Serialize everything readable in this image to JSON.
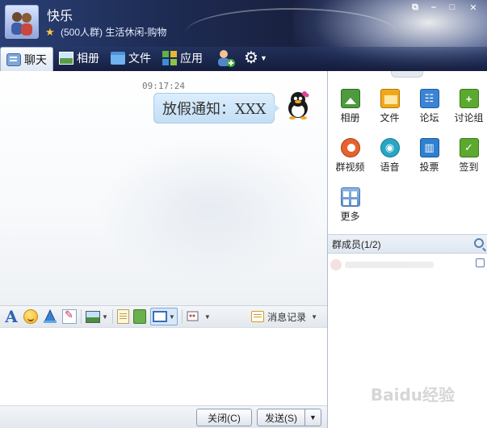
{
  "header": {
    "group_name": "快乐",
    "group_desc": "(500人群) 生活休闲-购物",
    "window_controls": [
      "restore",
      "minimize",
      "maximize",
      "close"
    ]
  },
  "tabs": [
    {
      "label": "聊天",
      "icon": "chat-icon",
      "active": true
    },
    {
      "label": "相册",
      "icon": "photo-icon",
      "active": false
    },
    {
      "label": "文件",
      "icon": "folder-icon",
      "active": false
    },
    {
      "label": "应用",
      "icon": "apps-icon",
      "active": false
    }
  ],
  "chat": {
    "timestamp": "09:17:24",
    "message": "放假通知：XXX"
  },
  "toolbar": {
    "font_label": "A",
    "history_label": "消息记录"
  },
  "footer": {
    "close_label": "关闭(C)",
    "send_label": "发送(S)"
  },
  "apps": [
    {
      "label": "相册",
      "icon": "album-icon",
      "color": "#4d9b3c"
    },
    {
      "label": "文件",
      "icon": "file-icon",
      "color": "#f0a81b"
    },
    {
      "label": "论坛",
      "icon": "forum-icon",
      "color": "#3b84d4"
    },
    {
      "label": "讨论组",
      "icon": "discussion-icon",
      "color": "#5ba92f"
    },
    {
      "label": "群视频",
      "icon": "group-video-icon",
      "color": "#e7622e"
    },
    {
      "label": "语音",
      "icon": "voice-icon",
      "color": "#28a6c4"
    },
    {
      "label": "投票",
      "icon": "vote-icon",
      "color": "#2f80cf"
    },
    {
      "label": "签到",
      "icon": "checkin-icon",
      "color": "#5ba92f"
    },
    {
      "label": "更多",
      "icon": "more-icon",
      "color": "#5d8fcc"
    }
  ],
  "members": {
    "header": "群成员(1/2)"
  },
  "watermark": "Baidu经验"
}
